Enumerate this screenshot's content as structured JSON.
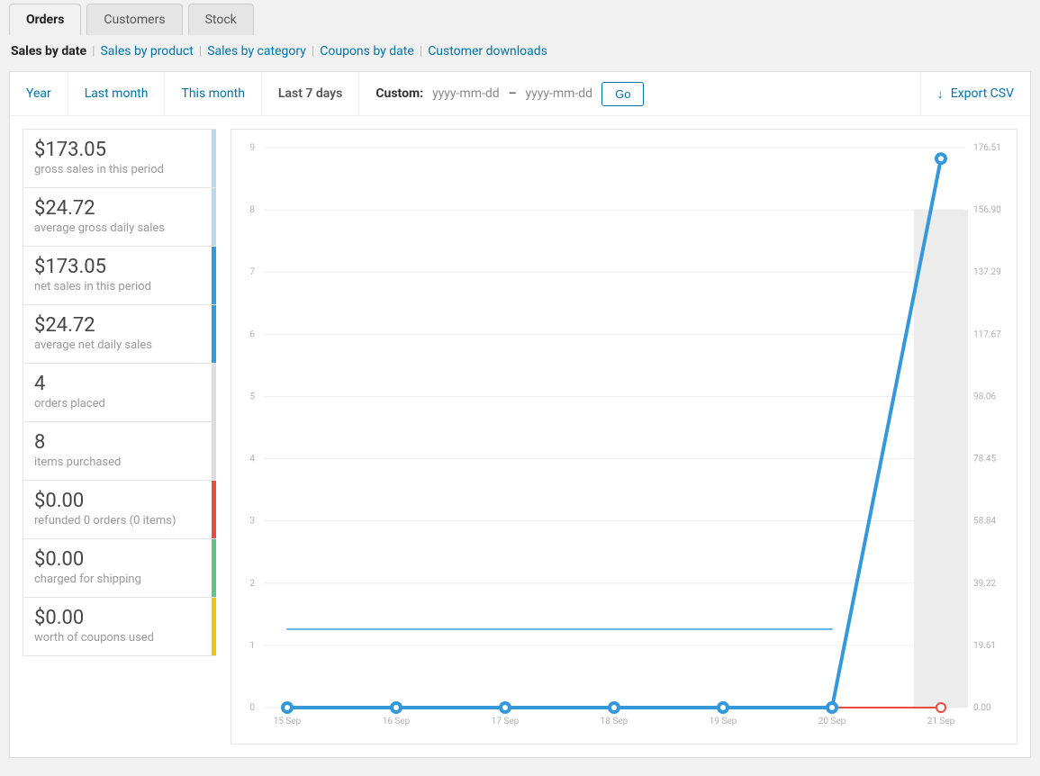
{
  "tabs_main": {
    "orders": "Orders",
    "customers": "Customers",
    "stock": "Stock",
    "active": "orders"
  },
  "subnav": {
    "label": "Sales by date",
    "links": [
      "Sales by product",
      "Sales by category",
      "Coupons by date",
      "Customer downloads"
    ]
  },
  "ranges": {
    "year": "Year",
    "last_month": "Last month",
    "this_month": "This month",
    "last7": "Last 7 days",
    "active": "last7",
    "custom_label": "Custom:",
    "date_placeholder": "yyyy-mm-dd",
    "go": "Go"
  },
  "export_label": "Export CSV",
  "legend": [
    {
      "value": "$173.05",
      "desc": "gross sales in this period",
      "stripe": "#b9d9ec"
    },
    {
      "value": "$24.72",
      "desc": "average gross daily sales",
      "stripe": "#b9d9ec"
    },
    {
      "value": "$173.05",
      "desc": "net sales in this period",
      "stripe": "#3498db"
    },
    {
      "value": "$24.72",
      "desc": "average net daily sales",
      "stripe": "#3498db"
    },
    {
      "value": "4",
      "desc": "orders placed",
      "stripe": "#dcdcde"
    },
    {
      "value": "8",
      "desc": "items purchased",
      "stripe": "#dcdcde"
    },
    {
      "value": "$0.00",
      "desc": "refunded 0 orders (0 items)",
      "stripe": "#e74c3c"
    },
    {
      "value": "$0.00",
      "desc": "charged for shipping",
      "stripe": "#5ec488"
    },
    {
      "value": "$0.00",
      "desc": "worth of coupons used",
      "stripe": "#f1c40f"
    }
  ],
  "chart_data": {
    "type": "line",
    "categories": [
      "15 Sep",
      "16 Sep",
      "17 Sep",
      "18 Sep",
      "19 Sep",
      "20 Sep",
      "21 Sep"
    ],
    "left_axis": {
      "ticks": [
        0,
        1,
        2,
        3,
        4,
        5,
        6,
        7,
        8,
        9
      ]
    },
    "right_axis": {
      "ticks": [
        0.0,
        19.61,
        39.22,
        58.84,
        78.45,
        98.06,
        117.67,
        137.29,
        156.9,
        176.51
      ]
    },
    "series": [
      {
        "name": "orders-bars",
        "type": "bar",
        "axis": "left",
        "color": "#e0e0e0",
        "values": [
          0,
          0,
          0,
          0,
          0,
          0,
          4
        ]
      },
      {
        "name": "items-bars",
        "type": "bar",
        "axis": "left",
        "color": "#ececec",
        "values": [
          0,
          0,
          0,
          0,
          0,
          0,
          8
        ]
      },
      {
        "name": "refunds",
        "type": "line",
        "axis": "right",
        "color": "#e74c3c",
        "stroke": 2,
        "markers": true,
        "values": [
          0,
          0,
          0,
          0,
          0,
          0,
          0
        ]
      },
      {
        "name": "net-sales",
        "type": "line",
        "axis": "right",
        "color": "#3498db",
        "stroke": 4,
        "markers": true,
        "values": [
          0,
          0,
          0,
          0,
          0,
          0,
          173.05
        ]
      },
      {
        "name": "avg-net-daily",
        "type": "line",
        "axis": "right",
        "color": "#5ab3e4",
        "stroke": 2,
        "markers": false,
        "values": [
          24.72,
          24.72,
          24.72,
          24.72,
          24.72,
          24.72,
          24.72
        ],
        "from_index": 0,
        "to_index": 5
      }
    ]
  },
  "colors": {
    "link": "#0073aa"
  }
}
